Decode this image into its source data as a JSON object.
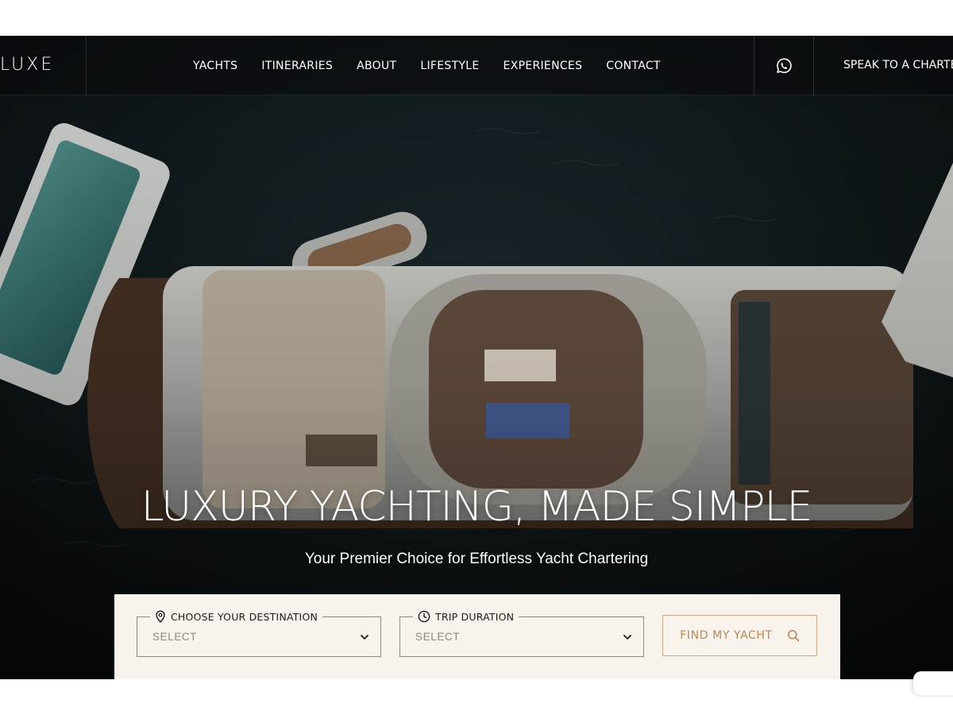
{
  "brand": {
    "logo_text": "LUXE"
  },
  "nav": {
    "links": [
      {
        "label": "YACHTS"
      },
      {
        "label": "ITINERARIES"
      },
      {
        "label": "ABOUT"
      },
      {
        "label": "LIFESTYLE"
      },
      {
        "label": "EXPERIENCES"
      },
      {
        "label": "CONTACT"
      }
    ],
    "whatsapp_icon": "whatsapp-icon",
    "cta_label": "SPEAK TO A CHARTE"
  },
  "hero": {
    "title": "LUXURY YACHTING, MADE SIMPLE",
    "subtitle": "Your Premier Choice for Effortless Yacht Chartering"
  },
  "search": {
    "destination": {
      "label": "CHOOSE YOUR DESTINATION",
      "value": "SELECT",
      "icon": "map-pin-icon"
    },
    "duration": {
      "label": "TRIP DURATION",
      "value": "SELECT",
      "icon": "clock-icon"
    },
    "button_label": "FIND MY YACHT",
    "button_icon": "search-icon"
  },
  "colors": {
    "panel_bg": "#f8f4ed",
    "accent": "#b88758",
    "accent_border": "#c9a987",
    "field_border": "#8e8880",
    "hero_dark": "#0c1114"
  }
}
